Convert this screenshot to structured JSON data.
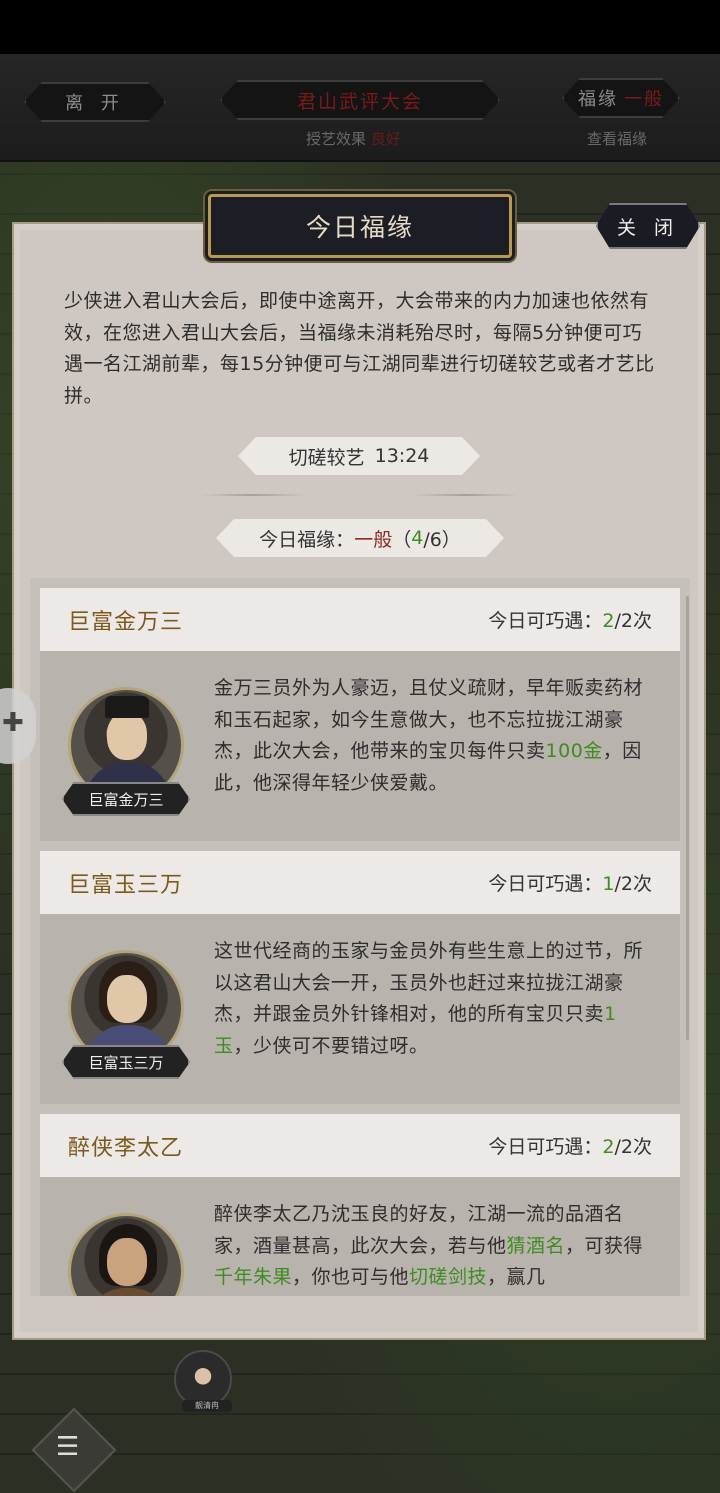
{
  "top_bar": {
    "leave_label": "离 开",
    "event_title": "君山武评大会",
    "fortune_button_label": "福缘",
    "fortune_button_value": "一般",
    "teach_effect_label": "授艺效果",
    "teach_effect_value": "良好",
    "view_fortune_label": "查看福缘"
  },
  "panel": {
    "title": "今日福缘",
    "close_label": "关 闭",
    "intro": "少侠进入君山大会后，即使中途离开，大会带来的内力加速也依然有效，在您进入君山大会后，当福缘未消耗殆尽时，每隔5分钟便可巧遇一名江湖前辈，每15分钟便可与江湖同辈进行切磋较艺或者才艺比拼。",
    "timer_label": "切磋较艺",
    "timer_value": "13:24",
    "fortune_label": "今日福缘：",
    "fortune_level": "一般",
    "fortune_open": "（",
    "fortune_current": "4",
    "fortune_rest": "/6）"
  },
  "cards": [
    {
      "name": "巨富金万三",
      "count_label": "今日可巧遇：",
      "count_current": "2",
      "count_rest": "/2次",
      "tag": "巨富金万三",
      "text_a": "金万三员外为人豪迈，且仗义疏财，早年贩卖药材和玉石起家，如今生意做大，也不忘拉拢江湖豪杰，此次大会，他带来的宝贝每件只卖",
      "text_hl": "100金",
      "text_b": "，因此，他深得年轻少侠爱戴。"
    },
    {
      "name": "巨富玉三万",
      "count_label": "今日可巧遇：",
      "count_current": "1",
      "count_rest": "/2次",
      "tag": "巨富玉三万",
      "text_a": "这世代经商的玉家与金员外有些生意上的过节，所以这君山大会一开，玉员外也赶过来拉拢江湖豪杰，并跟金员外针锋相对，他的所有宝贝只卖",
      "text_hl": "1玉",
      "text_b": "，少侠可不要错过呀。"
    },
    {
      "name": "醉侠李太乙",
      "count_label": "今日可巧遇：",
      "count_current": "2",
      "count_rest": "/2次",
      "text_a": "醉侠李太乙乃沈玉良的好友，江湖一流的品酒名家，酒量甚高，此次大会，若与他",
      "text_hl": "猜酒名",
      "text_b": "，可获得",
      "text_hl2": "千年朱果",
      "text_c": "，你也可与他",
      "text_hl3": "切磋剑技",
      "text_d": "，赢几"
    }
  ],
  "overlay": {
    "bottom_avatar_label": "靓清冉",
    "chat_icon": "chat-icon"
  }
}
